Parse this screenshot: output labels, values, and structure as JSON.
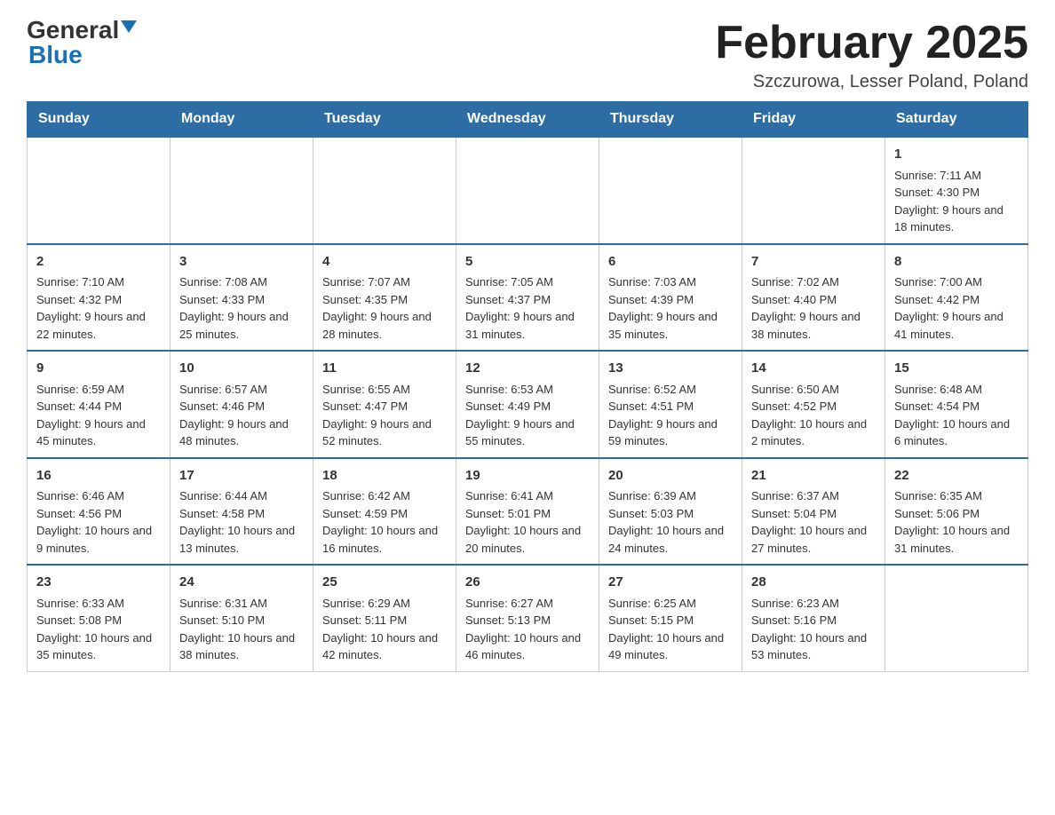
{
  "header": {
    "logo_general": "General",
    "logo_blue": "Blue",
    "month_title": "February 2025",
    "location": "Szczurowa, Lesser Poland, Poland"
  },
  "days_of_week": [
    "Sunday",
    "Monday",
    "Tuesday",
    "Wednesday",
    "Thursday",
    "Friday",
    "Saturday"
  ],
  "weeks": [
    [
      {
        "day": "",
        "sunrise": "",
        "sunset": "",
        "daylight": ""
      },
      {
        "day": "",
        "sunrise": "",
        "sunset": "",
        "daylight": ""
      },
      {
        "day": "",
        "sunrise": "",
        "sunset": "",
        "daylight": ""
      },
      {
        "day": "",
        "sunrise": "",
        "sunset": "",
        "daylight": ""
      },
      {
        "day": "",
        "sunrise": "",
        "sunset": "",
        "daylight": ""
      },
      {
        "day": "",
        "sunrise": "",
        "sunset": "",
        "daylight": ""
      },
      {
        "day": "1",
        "sunrise": "Sunrise: 7:11 AM",
        "sunset": "Sunset: 4:30 PM",
        "daylight": "Daylight: 9 hours and 18 minutes."
      }
    ],
    [
      {
        "day": "2",
        "sunrise": "Sunrise: 7:10 AM",
        "sunset": "Sunset: 4:32 PM",
        "daylight": "Daylight: 9 hours and 22 minutes."
      },
      {
        "day": "3",
        "sunrise": "Sunrise: 7:08 AM",
        "sunset": "Sunset: 4:33 PM",
        "daylight": "Daylight: 9 hours and 25 minutes."
      },
      {
        "day": "4",
        "sunrise": "Sunrise: 7:07 AM",
        "sunset": "Sunset: 4:35 PM",
        "daylight": "Daylight: 9 hours and 28 minutes."
      },
      {
        "day": "5",
        "sunrise": "Sunrise: 7:05 AM",
        "sunset": "Sunset: 4:37 PM",
        "daylight": "Daylight: 9 hours and 31 minutes."
      },
      {
        "day": "6",
        "sunrise": "Sunrise: 7:03 AM",
        "sunset": "Sunset: 4:39 PM",
        "daylight": "Daylight: 9 hours and 35 minutes."
      },
      {
        "day": "7",
        "sunrise": "Sunrise: 7:02 AM",
        "sunset": "Sunset: 4:40 PM",
        "daylight": "Daylight: 9 hours and 38 minutes."
      },
      {
        "day": "8",
        "sunrise": "Sunrise: 7:00 AM",
        "sunset": "Sunset: 4:42 PM",
        "daylight": "Daylight: 9 hours and 41 minutes."
      }
    ],
    [
      {
        "day": "9",
        "sunrise": "Sunrise: 6:59 AM",
        "sunset": "Sunset: 4:44 PM",
        "daylight": "Daylight: 9 hours and 45 minutes."
      },
      {
        "day": "10",
        "sunrise": "Sunrise: 6:57 AM",
        "sunset": "Sunset: 4:46 PM",
        "daylight": "Daylight: 9 hours and 48 minutes."
      },
      {
        "day": "11",
        "sunrise": "Sunrise: 6:55 AM",
        "sunset": "Sunset: 4:47 PM",
        "daylight": "Daylight: 9 hours and 52 minutes."
      },
      {
        "day": "12",
        "sunrise": "Sunrise: 6:53 AM",
        "sunset": "Sunset: 4:49 PM",
        "daylight": "Daylight: 9 hours and 55 minutes."
      },
      {
        "day": "13",
        "sunrise": "Sunrise: 6:52 AM",
        "sunset": "Sunset: 4:51 PM",
        "daylight": "Daylight: 9 hours and 59 minutes."
      },
      {
        "day": "14",
        "sunrise": "Sunrise: 6:50 AM",
        "sunset": "Sunset: 4:52 PM",
        "daylight": "Daylight: 10 hours and 2 minutes."
      },
      {
        "day": "15",
        "sunrise": "Sunrise: 6:48 AM",
        "sunset": "Sunset: 4:54 PM",
        "daylight": "Daylight: 10 hours and 6 minutes."
      }
    ],
    [
      {
        "day": "16",
        "sunrise": "Sunrise: 6:46 AM",
        "sunset": "Sunset: 4:56 PM",
        "daylight": "Daylight: 10 hours and 9 minutes."
      },
      {
        "day": "17",
        "sunrise": "Sunrise: 6:44 AM",
        "sunset": "Sunset: 4:58 PM",
        "daylight": "Daylight: 10 hours and 13 minutes."
      },
      {
        "day": "18",
        "sunrise": "Sunrise: 6:42 AM",
        "sunset": "Sunset: 4:59 PM",
        "daylight": "Daylight: 10 hours and 16 minutes."
      },
      {
        "day": "19",
        "sunrise": "Sunrise: 6:41 AM",
        "sunset": "Sunset: 5:01 PM",
        "daylight": "Daylight: 10 hours and 20 minutes."
      },
      {
        "day": "20",
        "sunrise": "Sunrise: 6:39 AM",
        "sunset": "Sunset: 5:03 PM",
        "daylight": "Daylight: 10 hours and 24 minutes."
      },
      {
        "day": "21",
        "sunrise": "Sunrise: 6:37 AM",
        "sunset": "Sunset: 5:04 PM",
        "daylight": "Daylight: 10 hours and 27 minutes."
      },
      {
        "day": "22",
        "sunrise": "Sunrise: 6:35 AM",
        "sunset": "Sunset: 5:06 PM",
        "daylight": "Daylight: 10 hours and 31 minutes."
      }
    ],
    [
      {
        "day": "23",
        "sunrise": "Sunrise: 6:33 AM",
        "sunset": "Sunset: 5:08 PM",
        "daylight": "Daylight: 10 hours and 35 minutes."
      },
      {
        "day": "24",
        "sunrise": "Sunrise: 6:31 AM",
        "sunset": "Sunset: 5:10 PM",
        "daylight": "Daylight: 10 hours and 38 minutes."
      },
      {
        "day": "25",
        "sunrise": "Sunrise: 6:29 AM",
        "sunset": "Sunset: 5:11 PM",
        "daylight": "Daylight: 10 hours and 42 minutes."
      },
      {
        "day": "26",
        "sunrise": "Sunrise: 6:27 AM",
        "sunset": "Sunset: 5:13 PM",
        "daylight": "Daylight: 10 hours and 46 minutes."
      },
      {
        "day": "27",
        "sunrise": "Sunrise: 6:25 AM",
        "sunset": "Sunset: 5:15 PM",
        "daylight": "Daylight: 10 hours and 49 minutes."
      },
      {
        "day": "28",
        "sunrise": "Sunrise: 6:23 AM",
        "sunset": "Sunset: 5:16 PM",
        "daylight": "Daylight: 10 hours and 53 minutes."
      },
      {
        "day": "",
        "sunrise": "",
        "sunset": "",
        "daylight": ""
      }
    ]
  ]
}
